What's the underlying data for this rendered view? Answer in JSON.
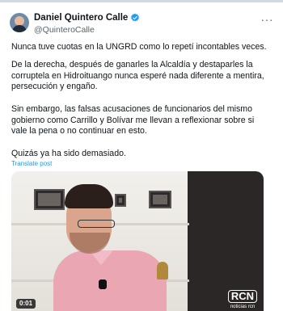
{
  "author": {
    "display_name": "Daniel Quintero Calle",
    "handle": "@QuinteroCalle",
    "verified": true
  },
  "icons": {
    "avatar": "avatar",
    "verified": "verified-badge-icon",
    "more": "more-options-icon"
  },
  "more_glyph": "···",
  "tweet": {
    "paragraphs": [
      "Nunca tuve cuotas en la UNGRD como lo repetí incontables veces.",
      "De la derecha, después de ganarles la Alcaldía y destaparles la corruptela en Hidroituango nunca esperé nada diferente a mentira, persecución y engaño.",
      "Sin embargo, las falsas acusaciones de funcionarios del mismo gobierno como Carrillo y Bolívar me llevan a reflexionar sobre si vale la pena o no continuar en esto.",
      "Quizás ya ha sido demasiado."
    ],
    "translate_label": "Translate post"
  },
  "media": {
    "type": "video",
    "timestamp": "0:01",
    "logo_mark": "RCN",
    "logo_text": "noticias rcn"
  },
  "colors": {
    "link": "#1d9bf0",
    "verified": "#1d9bf0",
    "text": "#0f1419",
    "secondary": "#536471"
  }
}
